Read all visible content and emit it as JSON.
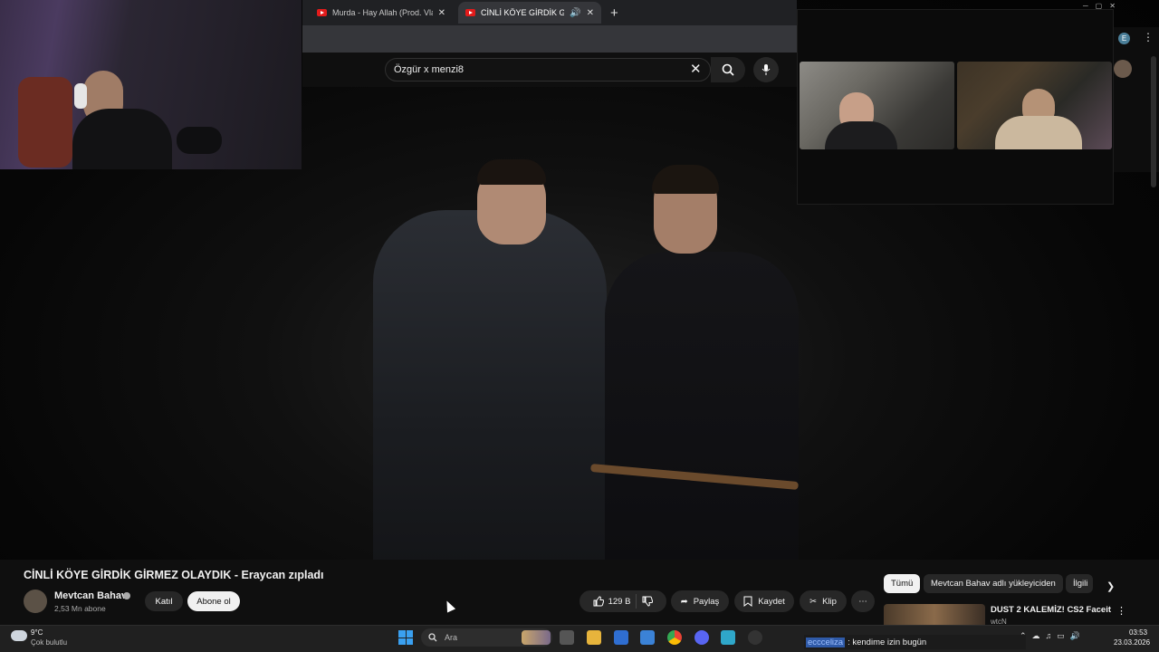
{
  "browser": {
    "tabs": [
      {
        "label": "Murda - Hay Allah (Prod. Vlado"
      },
      {
        "label": "CİNLİ KÖYE GİRDİK GİRMEZ OL"
      }
    ],
    "new_tab": "+"
  },
  "youtube": {
    "search": {
      "value": "Özgür x menzi8"
    },
    "video": {
      "title": "CİNLİ KÖYE GİRDİK GİRMEZ OLAYDIK - Eraycan zıpladı",
      "channel": "Mevtcan Bahav",
      "subscribers": "2,53 Mn abone",
      "join_label": "Katıl",
      "subscribe_label": "Abone ol",
      "likes": "129 B",
      "share_label": "Paylaş",
      "save_label": "Kaydet",
      "clip_label": "Klip"
    },
    "chips": [
      "Tümü",
      "Mevtcan Bahav adlı yükleyiciden",
      "İlgili"
    ],
    "recommendation": {
      "title": "DUST 2 KALEMİZ! CS2 Faceit",
      "channel": "wtcN"
    }
  },
  "profile_letter": "E",
  "taskbar": {
    "weather_temp": "9°C",
    "weather_desc": "Çok bulutlu",
    "search_placeholder": "Ara",
    "chat_user": "eccceliza",
    "chat_message": ": kendime izin bugün",
    "time": "03:53",
    "date": "23.03.2026"
  },
  "colors": {
    "youtube_red": "#e21b1b",
    "accent_blue": "#3aa0f0"
  }
}
